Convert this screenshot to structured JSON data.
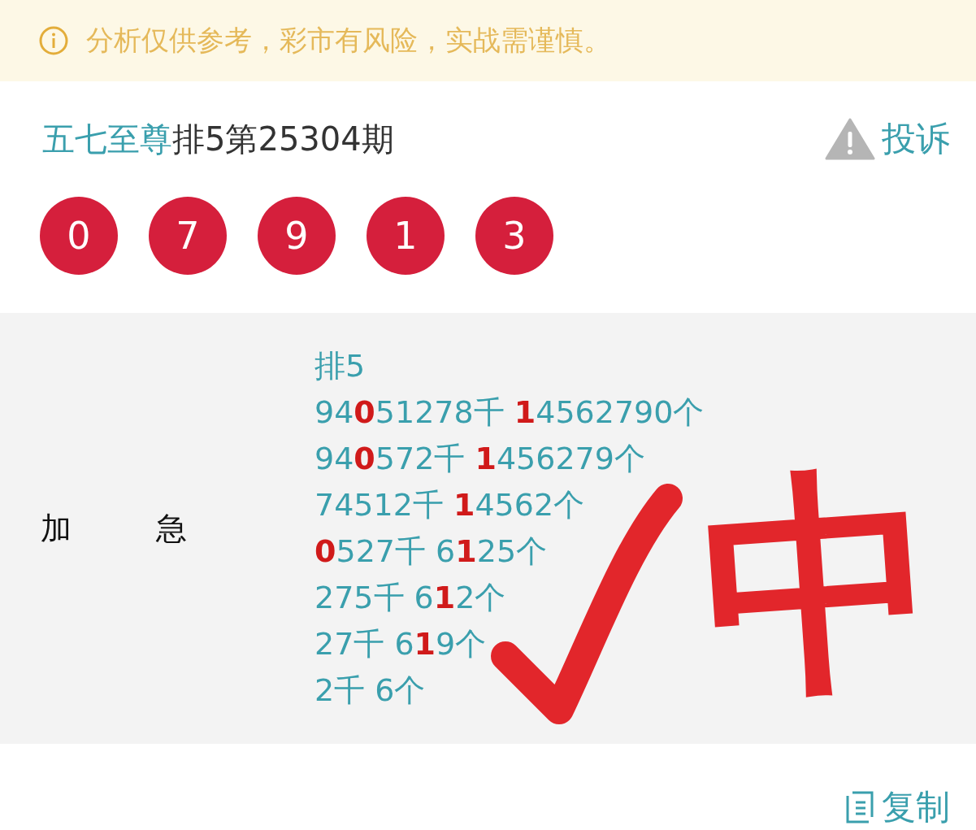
{
  "notice": {
    "text": "分析仅供参考，彩市有风险，实战需谨慎。"
  },
  "header": {
    "author": "五七至尊",
    "issue": "排5第25304期",
    "report": "投诉"
  },
  "numbers": [
    "0",
    "7",
    "9",
    "1",
    "3"
  ],
  "content": {
    "label": "加 急",
    "lines": [
      "排5",
      "94**0**51278千 **1**4562790个",
      "94**0**572千 **1**456279个",
      "74512千 **1**4562个",
      "**0**527千 6**1**25个",
      "275千 6**1**2个",
      "27千 6**1**9个",
      "2千 6个"
    ]
  },
  "annotation": {
    "text": "中"
  },
  "copy": "复制"
}
